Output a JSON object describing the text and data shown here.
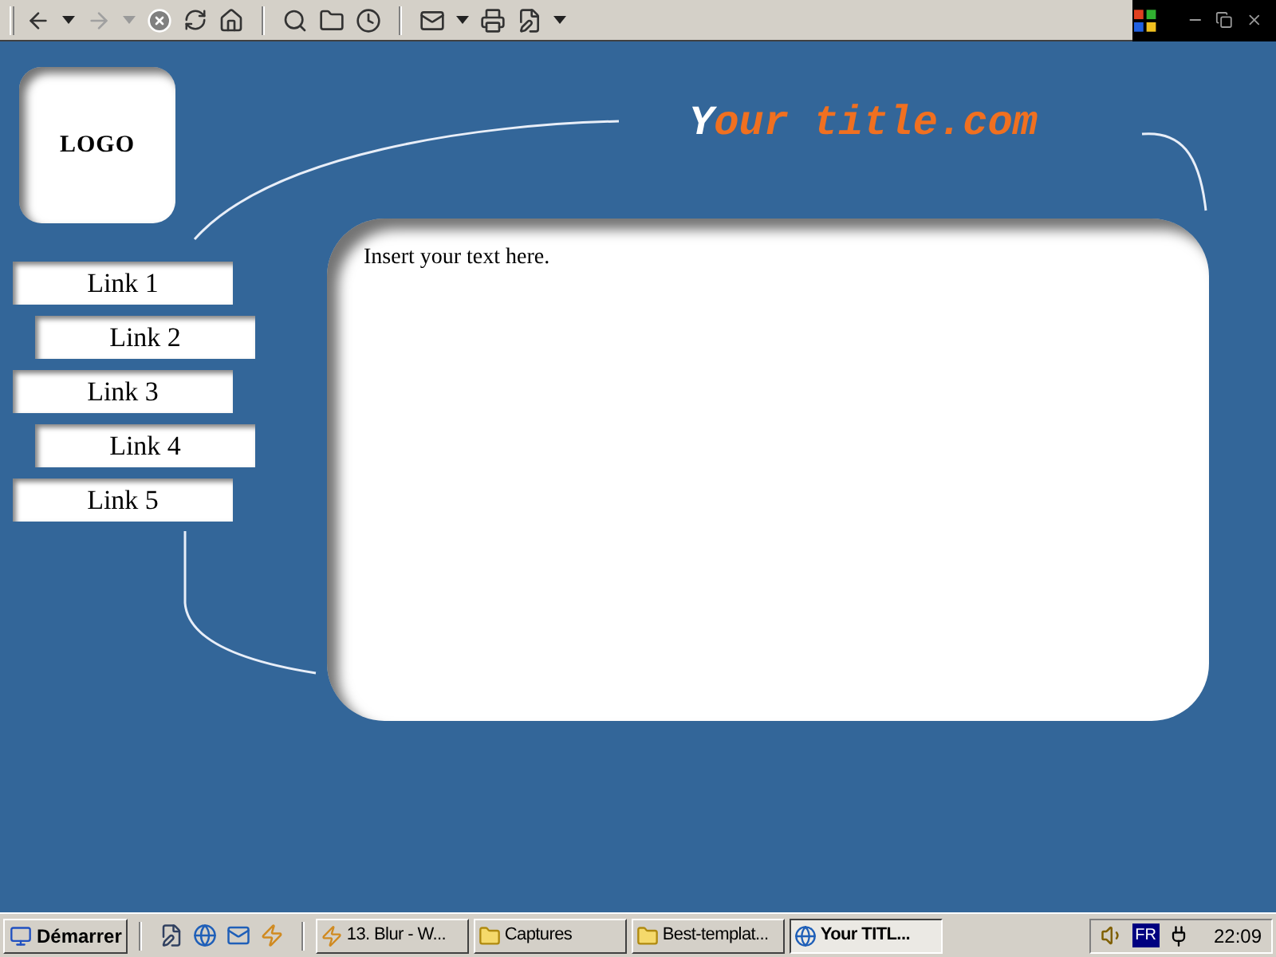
{
  "toolbar": {
    "nav": [
      {
        "disabled": false
      },
      {
        "disabled": true
      }
    ]
  },
  "logo": {
    "label": "LOGO"
  },
  "title": "Your title.com",
  "links": [
    {
      "label": "Link 1"
    },
    {
      "label": "Link 2"
    },
    {
      "label": "Link 3"
    },
    {
      "label": "Link 4"
    },
    {
      "label": "Link 5"
    }
  ],
  "content": {
    "text": "Insert your text here."
  },
  "taskbar": {
    "start": "Démarrer",
    "tasks": [
      {
        "label": "13. Blur - W...",
        "kind": "app",
        "selected": false
      },
      {
        "label": "Captures",
        "kind": "folder",
        "selected": false
      },
      {
        "label": "Best-templat...",
        "kind": "folder",
        "selected": false
      },
      {
        "label": "Your TITL...",
        "kind": "browser",
        "selected": true
      }
    ],
    "language": "FR",
    "clock": "22:09"
  }
}
